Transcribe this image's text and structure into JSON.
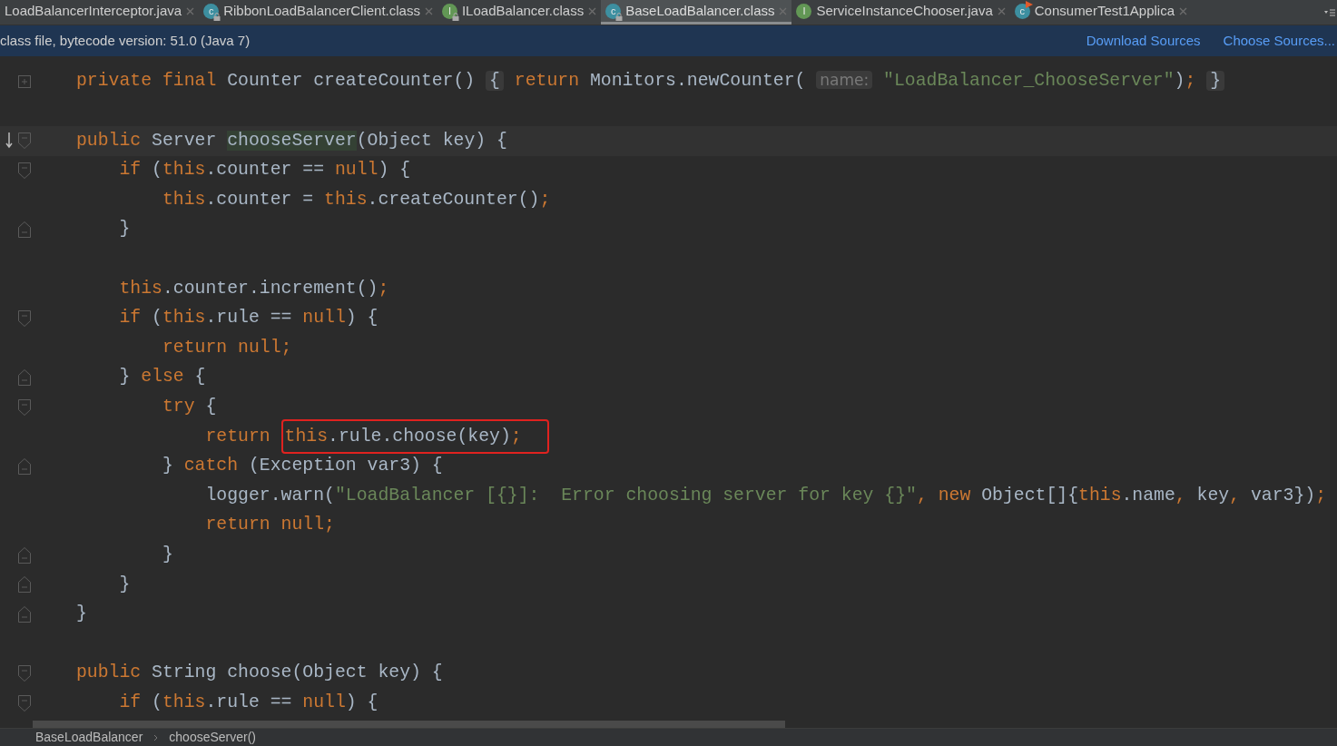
{
  "tabs": [
    {
      "label": "LoadBalancerInterceptor.java",
      "selected": false
    },
    {
      "label": "RibbonLoadBalancerClient.class",
      "selected": false,
      "icon": {
        "kind": "class",
        "letter": "c",
        "locked": true
      }
    },
    {
      "label": "ILoadBalancer.class",
      "selected": false,
      "icon": {
        "kind": "interface",
        "letter": "I",
        "locked": true
      }
    },
    {
      "label": "BaseLoadBalancer.class",
      "selected": true,
      "icon": {
        "kind": "class",
        "letter": "c",
        "locked": true
      }
    },
    {
      "label": "ServiceInstanceChooser.java",
      "selected": false,
      "icon": {
        "kind": "interface",
        "letter": "I",
        "locked": false
      }
    },
    {
      "label": "ConsumerTest1Applica",
      "selected": false,
      "icon": {
        "kind": "runnable",
        "letter": "c",
        "locked": false
      }
    }
  ],
  "notice": {
    "text": "class file, bytecode version: 51.0 (Java 7)",
    "links": [
      "Download Sources",
      "Choose Sources..."
    ]
  },
  "lines": [
    {
      "kind": "plus",
      "tokens": [
        {
          "kind": "kw",
          "text": "private "
        },
        {
          "kind": "kw",
          "text": "final "
        },
        {
          "kind": "id",
          "text": "Counter createCounter() "
        },
        {
          "kind": "fold",
          "text": "{"
        },
        {
          "kind": "kw",
          "text": " return "
        },
        {
          "kind": "id",
          "text": "Monitors.newCounter( "
        },
        {
          "kind": "hint",
          "text": "name:"
        },
        {
          "kind": "str",
          "text": " \"LoadBalancer_ChooseServer\""
        },
        {
          "kind": "id",
          "text": ")"
        },
        {
          "kind": "kw",
          "text": "; "
        },
        {
          "kind": "fold",
          "text": "}"
        }
      ]
    },
    {
      "kind": "plain"
    },
    {
      "kind": "start",
      "current": true,
      "override": true,
      "tokens": [
        {
          "kind": "kw",
          "text": "public "
        },
        {
          "kind": "id",
          "text": "Server "
        },
        {
          "kind": "usage",
          "text": "chooseServer"
        },
        {
          "kind": "id",
          "text": "(Object key) {"
        }
      ]
    },
    {
      "kind": "start",
      "tokens": [
        {
          "kind": "kw",
          "text": "    if "
        },
        {
          "kind": "id",
          "text": "("
        },
        {
          "kind": "kw",
          "text": "this"
        },
        {
          "kind": "id",
          "text": ".counter == "
        },
        {
          "kind": "kw",
          "text": "null"
        },
        {
          "kind": "id",
          "text": ") {"
        }
      ]
    },
    {
      "kind": "plain",
      "tokens": [
        {
          "kind": "kw",
          "text": "        this"
        },
        {
          "kind": "id",
          "text": ".counter = "
        },
        {
          "kind": "kw",
          "text": "this"
        },
        {
          "kind": "id",
          "text": ".createCounter()"
        },
        {
          "kind": "kw",
          "text": ";"
        }
      ]
    },
    {
      "kind": "end",
      "tokens": [
        {
          "kind": "id",
          "text": "    }"
        }
      ]
    },
    {
      "kind": "plain"
    },
    {
      "kind": "plain",
      "tokens": [
        {
          "kind": "kw",
          "text": "    this"
        },
        {
          "kind": "id",
          "text": ".counter.increment()"
        },
        {
          "kind": "kw",
          "text": ";"
        }
      ]
    },
    {
      "kind": "start",
      "tokens": [
        {
          "kind": "kw",
          "text": "    if "
        },
        {
          "kind": "id",
          "text": "("
        },
        {
          "kind": "kw",
          "text": "this"
        },
        {
          "kind": "id",
          "text": ".rule == "
        },
        {
          "kind": "kw",
          "text": "null"
        },
        {
          "kind": "id",
          "text": ") {"
        }
      ]
    },
    {
      "kind": "plain",
      "tokens": [
        {
          "kind": "kw",
          "text": "        return null;"
        }
      ]
    },
    {
      "kind": "end",
      "tokens": [
        {
          "kind": "id",
          "text": "    } "
        },
        {
          "kind": "kw",
          "text": "else "
        },
        {
          "kind": "id",
          "text": "{"
        }
      ]
    },
    {
      "kind": "start",
      "tokens": [
        {
          "kind": "kw",
          "text": "        try "
        },
        {
          "kind": "id",
          "text": "{"
        }
      ]
    },
    {
      "kind": "plain",
      "tokens": [
        {
          "kind": "kw",
          "text": "            return "
        },
        {
          "kind": "box",
          "tokens": [
            {
              "kind": "kw",
              "text": "this"
            },
            {
              "kind": "id",
              "text": ".rule.choose(key)"
            },
            {
              "kind": "kw",
              "text": ";"
            }
          ]
        }
      ]
    },
    {
      "kind": "end",
      "tokens": [
        {
          "kind": "id",
          "text": "        } "
        },
        {
          "kind": "kw",
          "text": "catch "
        },
        {
          "kind": "id",
          "text": "(Exception var3) {"
        }
      ]
    },
    {
      "kind": "plain",
      "tokens": [
        {
          "kind": "id",
          "text": "            logger.warn("
        },
        {
          "kind": "str",
          "text": "\"LoadBalancer [{}]:  Error choosing server for key {}\""
        },
        {
          "kind": "kw",
          "text": ", new "
        },
        {
          "kind": "id",
          "text": "Object[]{"
        },
        {
          "kind": "kw",
          "text": "this"
        },
        {
          "kind": "id",
          "text": ".name"
        },
        {
          "kind": "kw",
          "text": ", "
        },
        {
          "kind": "id",
          "text": "key"
        },
        {
          "kind": "kw",
          "text": ", "
        },
        {
          "kind": "id",
          "text": "var3})"
        },
        {
          "kind": "kw",
          "text": ";"
        }
      ]
    },
    {
      "kind": "plain",
      "tokens": [
        {
          "kind": "kw",
          "text": "            return null;"
        }
      ]
    },
    {
      "kind": "end",
      "tokens": [
        {
          "kind": "id",
          "text": "        }"
        }
      ]
    },
    {
      "kind": "end",
      "tokens": [
        {
          "kind": "id",
          "text": "    }"
        }
      ]
    },
    {
      "kind": "end",
      "tokens": [
        {
          "kind": "id",
          "text": "}"
        }
      ]
    },
    {
      "kind": "plain"
    },
    {
      "kind": "start",
      "tokens": [
        {
          "kind": "kw",
          "text": "public "
        },
        {
          "kind": "id",
          "text": "String choose(Object key) {"
        }
      ]
    },
    {
      "kind": "start",
      "tokens": [
        {
          "kind": "kw",
          "text": "    if "
        },
        {
          "kind": "id",
          "text": "("
        },
        {
          "kind": "kw",
          "text": "this"
        },
        {
          "kind": "id",
          "text": ".rule == "
        },
        {
          "kind": "kw",
          "text": "null"
        },
        {
          "kind": "id",
          "text": ") {"
        }
      ]
    }
  ],
  "breadcrumb": [
    "BaseLoadBalancer",
    "chooseServer()"
  ]
}
